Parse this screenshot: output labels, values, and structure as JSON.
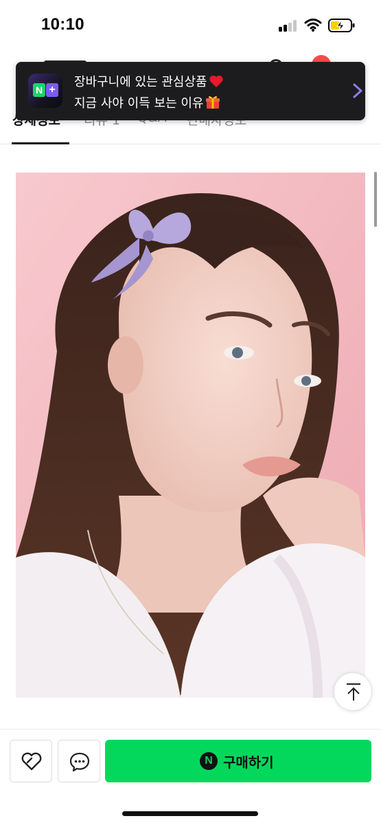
{
  "status_bar": {
    "time": "10:10",
    "icons": [
      "signal-icon",
      "wifi-icon",
      "battery-charging-icon"
    ]
  },
  "header": {
    "icons": [
      "back-icon",
      "search-icon",
      "cart-icon"
    ]
  },
  "tabs": [
    {
      "label": "상세정보",
      "active": true
    },
    {
      "label": "리뷰 1",
      "active": false
    },
    {
      "label": "Q&A",
      "active": false
    },
    {
      "label": "판매자정보",
      "active": false
    }
  ],
  "toast": {
    "app_badge": "N+",
    "line1": "장바구니에 있는 관심상품",
    "line1_emoji": "❤️",
    "line2": "지금 사야 이득 보는 이유",
    "line2_emoji": "🎁",
    "icon": "chevron-right-icon"
  },
  "product_image": {
    "icon": "product-photo"
  },
  "scroll_top": {
    "icon": "arrow-up-icon"
  },
  "bottom_bar": {
    "like_icon": "heart-icon",
    "talk_icon": "chat-bubble-icon",
    "buy_logo": "N",
    "buy_label": "구매하기"
  },
  "colors": {
    "buy_green": "#03d85d",
    "toast_bg": "#1c1c1e",
    "accent_purple": "#7b5cf0",
    "badge_red": "#ff4a4a"
  }
}
